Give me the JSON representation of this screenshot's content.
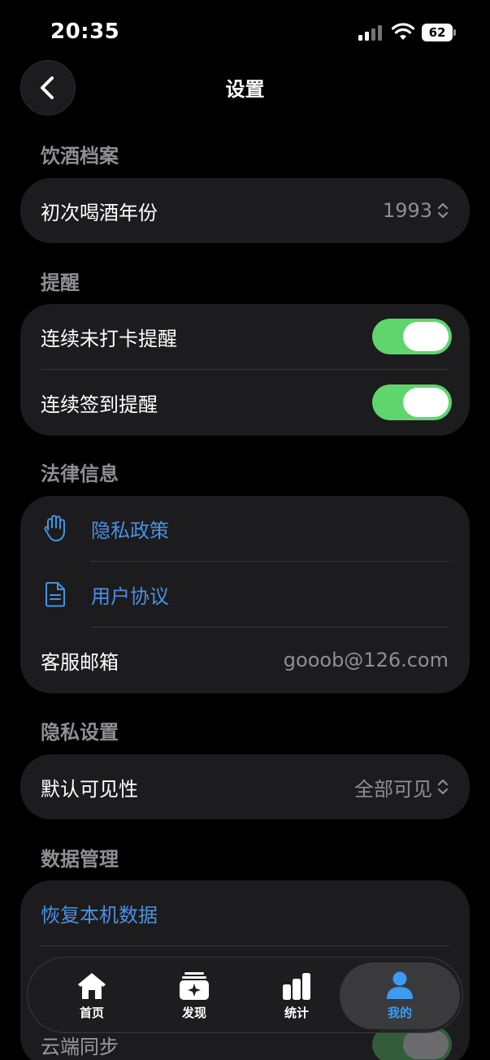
{
  "status_bar": {
    "time": "20:35",
    "battery": "62"
  },
  "header": {
    "title": "设置"
  },
  "sections": {
    "drinking": {
      "title": "饮酒档案",
      "first_year_label": "初次喝酒年份",
      "first_year_value": "1993"
    },
    "reminders": {
      "title": "提醒",
      "missed_checkin_label": "连续未打卡提醒",
      "missed_checkin_on": true,
      "streak_label": "连续签到提醒",
      "streak_on": true
    },
    "legal": {
      "title": "法律信息",
      "privacy_policy": "隐私政策",
      "user_agreement": "用户协议",
      "support_email_label": "客服邮箱",
      "support_email_value": "gooob@126.com"
    },
    "privacy": {
      "title": "隐私设置",
      "visibility_label": "默认可见性",
      "visibility_value": "全部可见"
    },
    "data": {
      "title": "数据管理",
      "restore_label": "恢复本机数据",
      "cloud_sync_label": "云端同步"
    }
  },
  "tabs": [
    {
      "label": "首页",
      "icon": "home-icon"
    },
    {
      "label": "发现",
      "icon": "discover-icon"
    },
    {
      "label": "统计",
      "icon": "stats-icon"
    },
    {
      "label": "我的",
      "icon": "profile-icon",
      "active": true
    }
  ],
  "colors": {
    "accent": "#4a90e2",
    "toggle_on": "#5fd56e",
    "tab_active": "#3a9cf5"
  }
}
